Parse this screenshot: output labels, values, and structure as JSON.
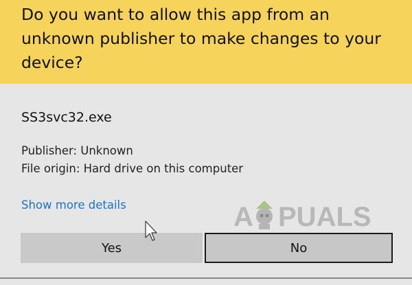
{
  "dialog": {
    "question": "Do you want to allow this app from an unknown publisher to make changes to your device?",
    "app_name": "SS3svc32.exe",
    "publisher": "Publisher: Unknown",
    "file_origin": "File origin: Hard drive on this computer",
    "show_details_label": "Show more details",
    "yes_label": "Yes",
    "no_label": "No",
    "header_color": "#f6d35a",
    "link_color": "#1a73c9"
  },
  "watermark": {
    "text_left": "A",
    "text_right": "PUALS"
  },
  "icons": {
    "cursor": "mouse-pointer-icon",
    "watermark_mascot": "appuals-mascot-icon"
  }
}
